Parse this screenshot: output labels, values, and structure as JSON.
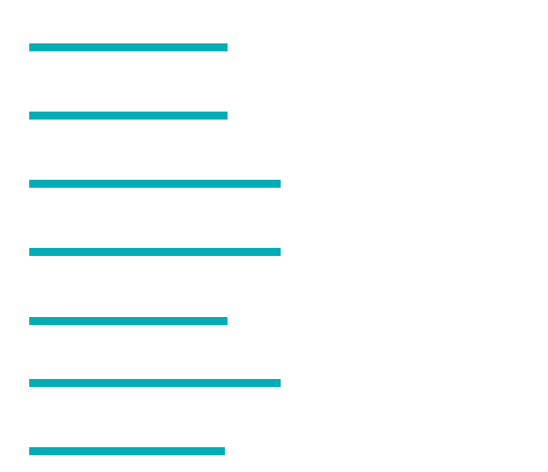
{
  "colors": {
    "background": "#ffffff",
    "accent": "#00adb5"
  },
  "placeholder_lines": {
    "count": 7
  }
}
